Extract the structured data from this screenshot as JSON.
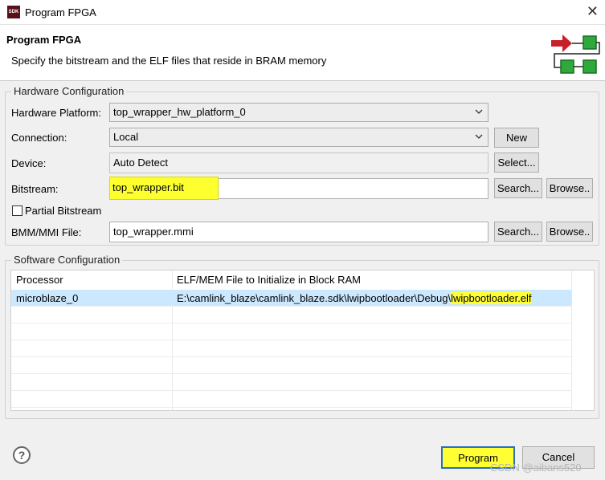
{
  "window": {
    "title": "Program FPGA",
    "app_icon": "SDK",
    "close_glyph": "✕"
  },
  "header": {
    "title": "Program FPGA",
    "description": "Specify the bitstream and the ELF files that reside in BRAM memory"
  },
  "hardware": {
    "legend": "Hardware Configuration",
    "platform_label": "Hardware Platform:",
    "platform_value": "top_wrapper_hw_platform_0",
    "connection_label": "Connection:",
    "connection_value": "Local",
    "new_button": "New",
    "device_label": "Device:",
    "device_value": "Auto Detect",
    "select_button": "Select...",
    "bitstream_label": "Bitstream:",
    "bitstream_value": "top_wrapper.bit",
    "search_button": "Search...",
    "browse_button": "Browse..",
    "partial_label": "Partial Bitstream",
    "partial_checked": false,
    "bmm_label": "BMM/MMI File:",
    "bmm_value": "top_wrapper.mmi"
  },
  "software": {
    "legend": "Software Configuration",
    "columns": [
      "Processor",
      "ELF/MEM File to Initialize in Block RAM"
    ],
    "rows": [
      {
        "processor": "microblaze_0",
        "elf_prefix": "E:\\camlink_blaze\\camlink_blaze.sdk\\lwipbootloader\\Debug\\",
        "elf_name": "lwipbootloader.elf"
      }
    ]
  },
  "footer": {
    "help_glyph": "?",
    "program_button": "Program",
    "cancel_button": "Cancel",
    "watermark": "CSDN @aibans520"
  },
  "colors": {
    "highlight": "#ffff33",
    "selection": "#cce8ff",
    "icon_red": "#c8202a",
    "icon_green": "#2fa83c"
  }
}
